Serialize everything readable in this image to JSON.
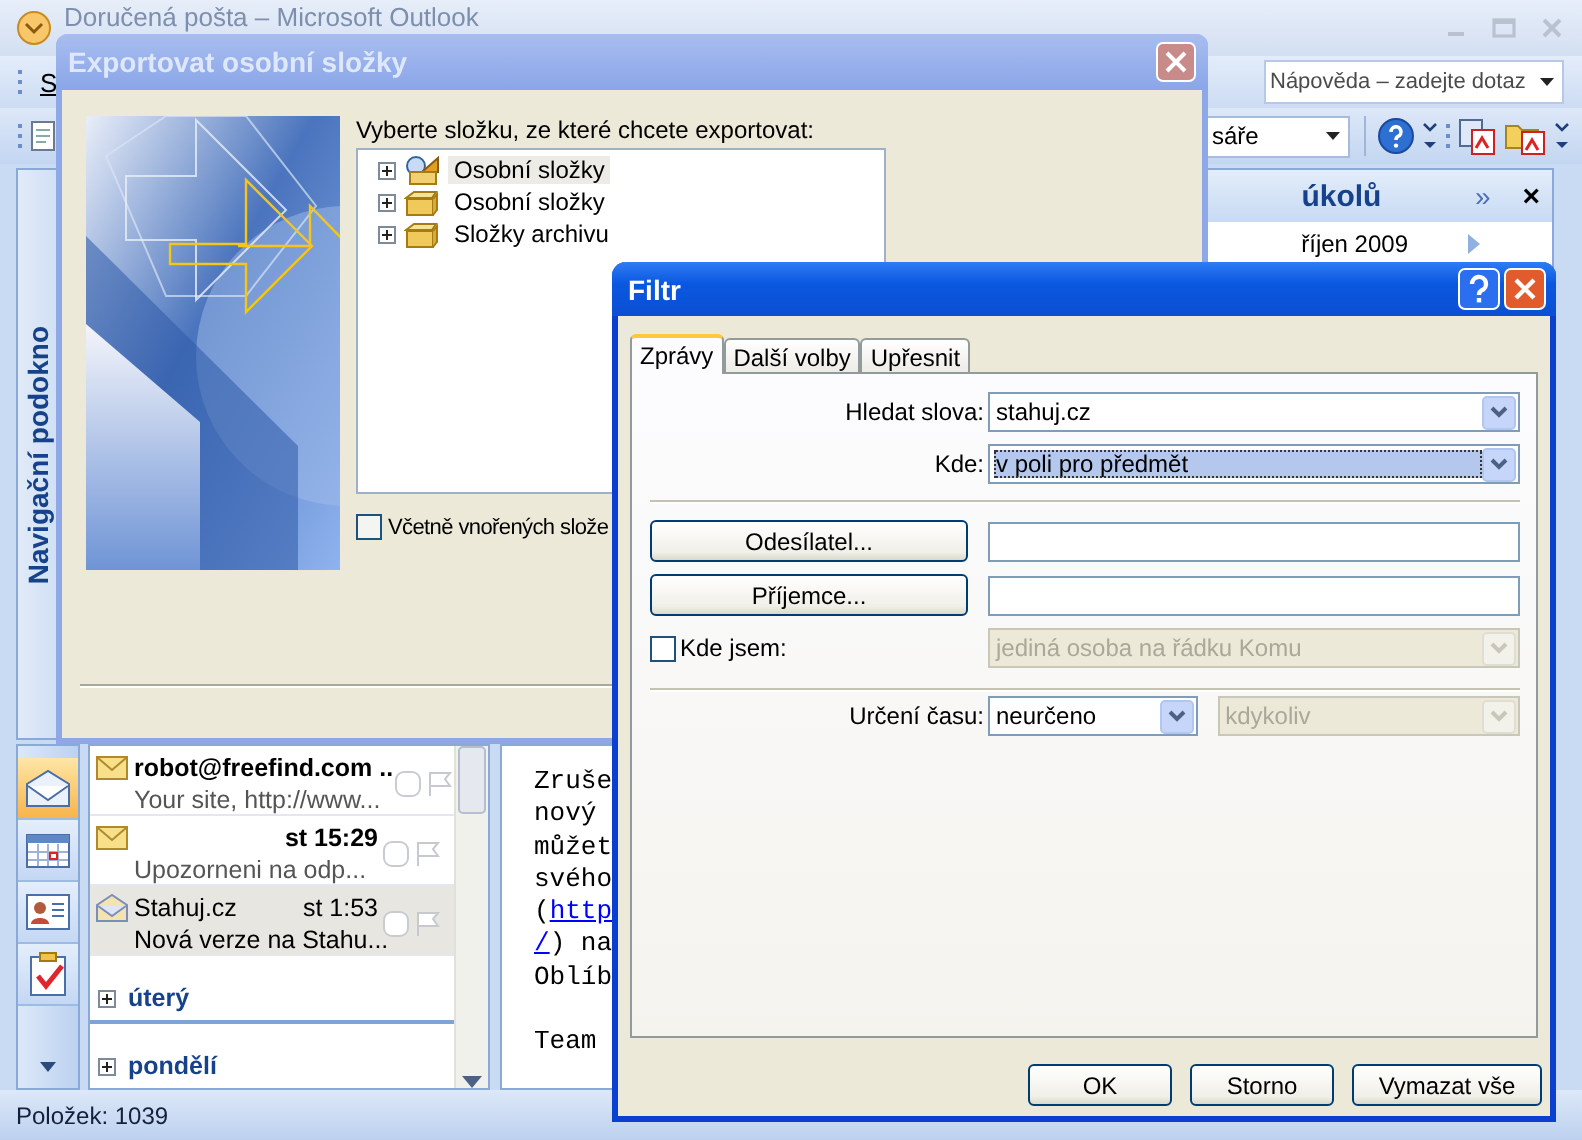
{
  "outlook": {
    "title": "Doručená pošta – Microsoft Outlook",
    "menu": [
      "S"
    ],
    "help_box": {
      "placeholder": "Nápověda – zadejte dotaz"
    },
    "view_search": {
      "value": "sáře"
    },
    "navigation_pane": {
      "label": "Navigační podokno"
    },
    "nav_buttons": [
      {
        "kind": "mail",
        "selected": true
      },
      {
        "kind": "calendar",
        "selected": false
      },
      {
        "kind": "contacts",
        "selected": false
      },
      {
        "kind": "tasks",
        "selected": false
      }
    ],
    "messages": [
      {
        "sender": "robot@freefind.com ..",
        "preview": "Your site, http://www...",
        "unread": true,
        "selected": false
      },
      {
        "time": "st 15:29",
        "preview": "Upozorneni na odp...",
        "unread": true,
        "selected": false
      },
      {
        "sender": "Stahuj.cz",
        "time": "st 1:53",
        "preview": "Nová verze na Stahu...",
        "unread": false,
        "selected": true
      }
    ],
    "groups": [
      {
        "label": "úterý",
        "expanded": false
      },
      {
        "label": "pondělí",
        "expanded": false
      }
    ],
    "reading_pane": {
      "paragraphs": [
        {
          "lines": [
            [
              {
                "kind": "text",
                "text": "Zruše"
              }
            ],
            [
              {
                "kind": "text",
                "text": "nový"
              }
            ],
            [
              {
                "kind": "text",
                "text": "můžet"
              }
            ],
            [
              {
                "kind": "text",
                "text": "svého"
              }
            ],
            [
              {
                "kind": "text",
                "text": "("
              },
              {
                "kind": "link",
                "text": "http"
              }
            ],
            [
              {
                "kind": "link",
                "text": "/"
              },
              {
                "kind": "text",
                "text": ") na"
              }
            ],
            [
              {
                "kind": "text",
                "text": "Oblíb"
              }
            ]
          ]
        },
        {
          "lines": [
            [
              {
                "kind": "text",
                "text": "Team"
              }
            ]
          ]
        }
      ]
    },
    "todo_bar": {
      "title": "úkolů",
      "more": "»",
      "close": "×",
      "month": "říjen 2009"
    },
    "status_bar": "Položek: 1039"
  },
  "export_dialog": {
    "title": "Exportovat osobní složky",
    "prompt": "Vyberte složku, ze které chcete exportovat:",
    "folders": [
      {
        "label": "Osobní složky",
        "kind": "home",
        "selected": true,
        "expanded": false
      },
      {
        "label": "Osobní složky",
        "kind": "folder",
        "selected": false,
        "expanded": false
      },
      {
        "label": "Složky archivu",
        "kind": "folder",
        "selected": false,
        "expanded": false
      }
    ],
    "include_subfolders": {
      "label": "Včetně vnořených slože",
      "checked": false
    }
  },
  "filter_dialog": {
    "title": "Filtr",
    "tabs": [
      {
        "label": "Zprávy",
        "selected": true
      },
      {
        "label": "Další volby",
        "selected": false
      },
      {
        "label": "Upřesnit",
        "selected": false
      }
    ],
    "search_words": {
      "label": "Hledat slova:",
      "value": "stahuj.cz"
    },
    "where": {
      "label": "Kde:",
      "value": "v poli pro předmět",
      "focused": true
    },
    "sender_button": "Odesílatel...",
    "recipient_button": "Příjemce...",
    "where_am_i": {
      "label": "Kde jsem:",
      "checked": false,
      "value": "jediná osoba na řádku Komu",
      "disabled": true
    },
    "time": {
      "label": "Určení času:",
      "value": "neurčeno",
      "range": {
        "value": "kdykoliv",
        "disabled": true
      }
    },
    "buttons": [
      "OK",
      "Storno",
      "Vymazat vše"
    ]
  }
}
